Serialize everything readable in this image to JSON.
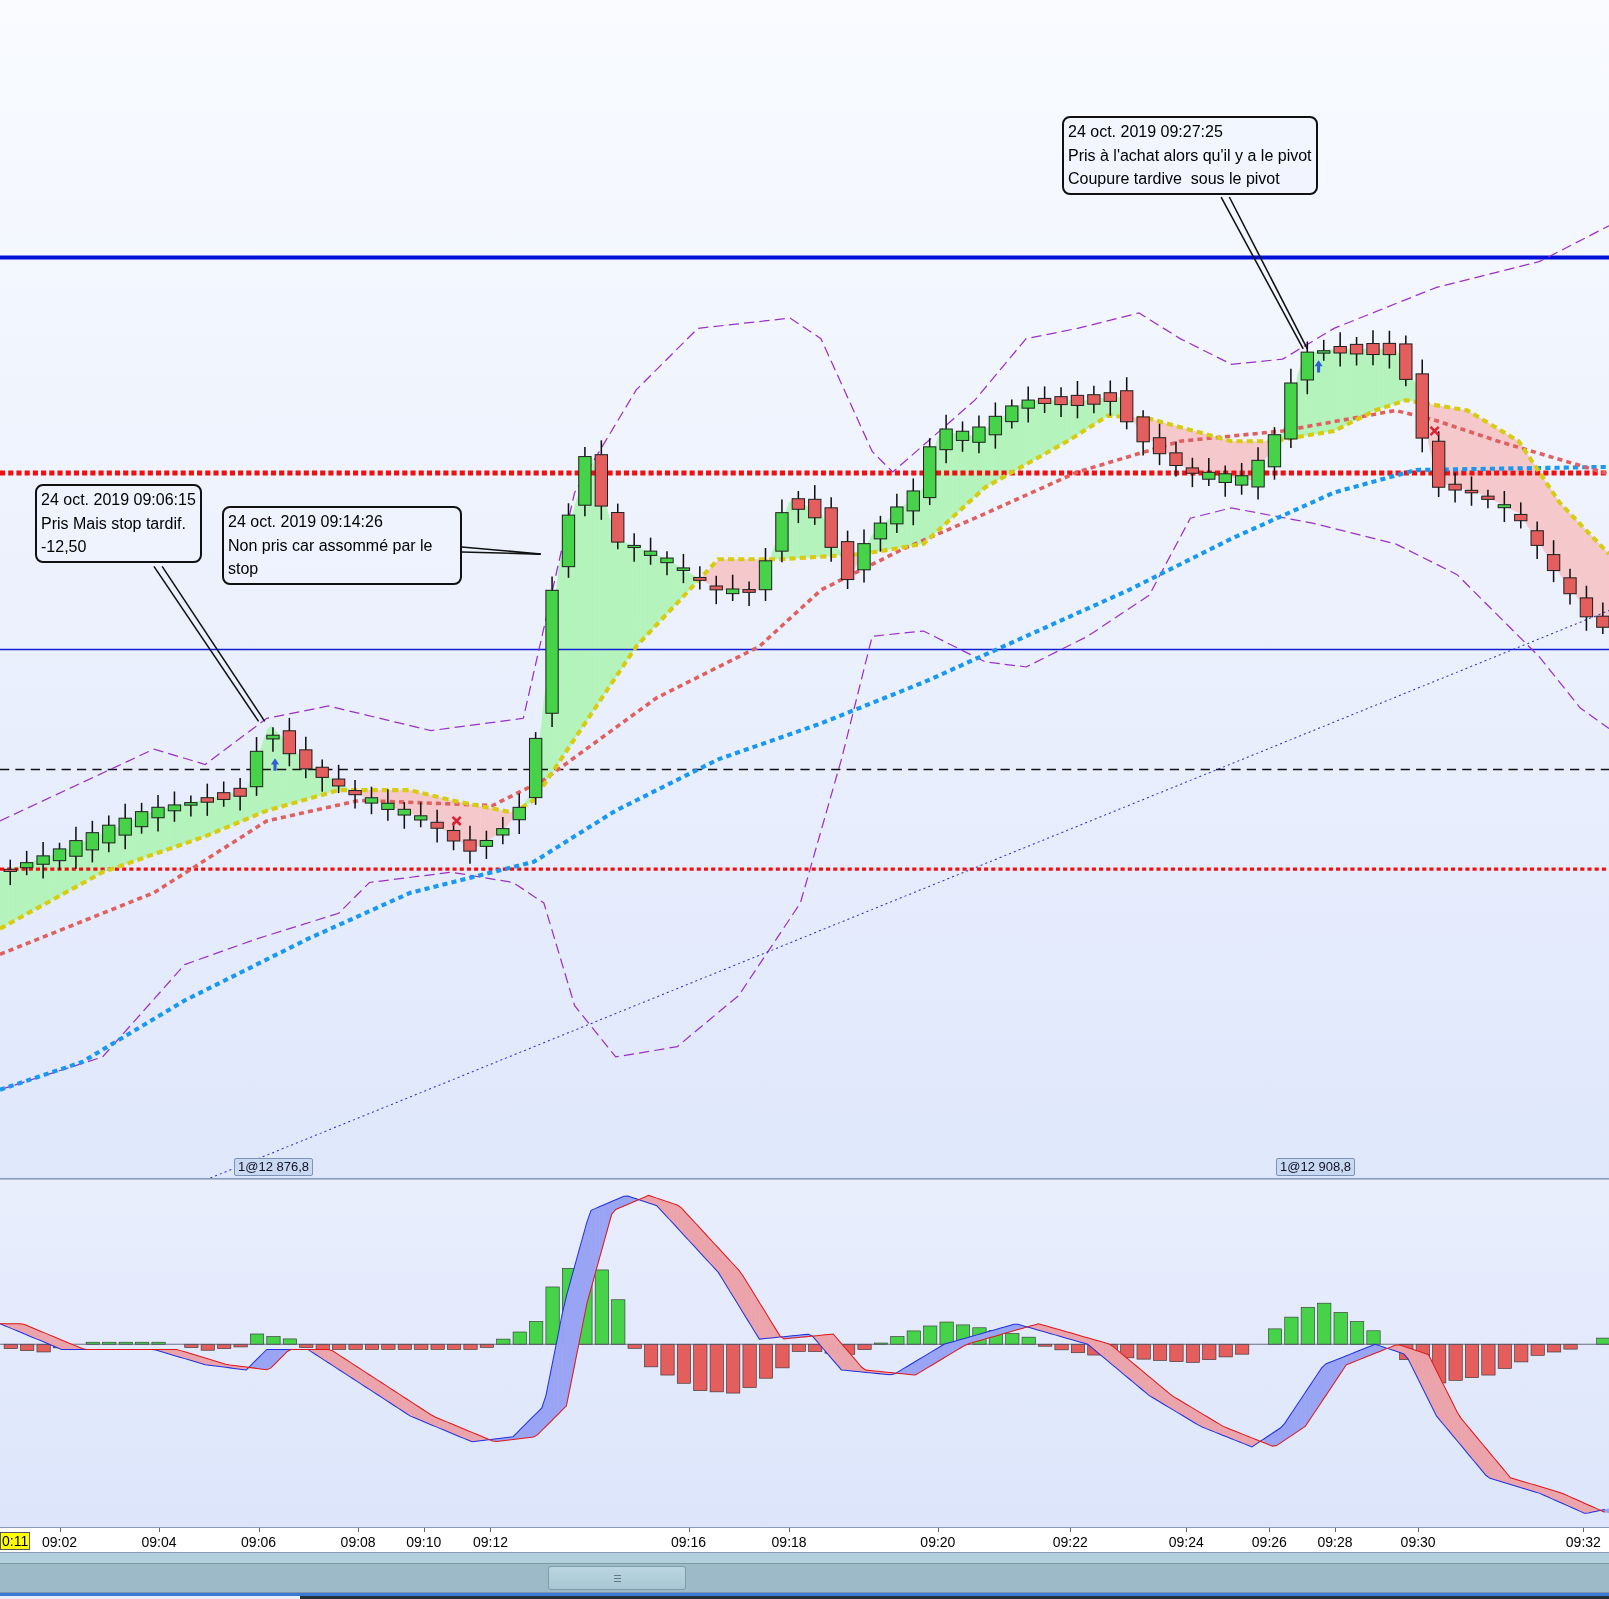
{
  "chart": {
    "callouts": [
      {
        "lines": [
          "24 oct. 2019 09:06:15",
          "Pris Mais stop tardif.",
          "-12,50"
        ]
      },
      {
        "lines": [
          "24 oct. 2019 09:14:26",
          "Non pris car assommé par le stop"
        ]
      },
      {
        "lines": [
          "24 oct. 2019 09:27:25",
          "Pris à l'achat alors qu'il y a le pivot",
          "Coupure tardive  sous le pivot"
        ]
      }
    ],
    "order_labels": [
      "1@12 876,8",
      "1@12 908,8"
    ]
  },
  "time_axis": {
    "current_time": "0:11",
    "labels": [
      "09:02",
      "09:04",
      "09:06",
      "09:08",
      "09:10",
      "09:12",
      "09:16",
      "09:18",
      "09:20",
      "09:22",
      "09:24",
      "09:26",
      "09:28",
      "09:30",
      "09:32"
    ]
  }
}
